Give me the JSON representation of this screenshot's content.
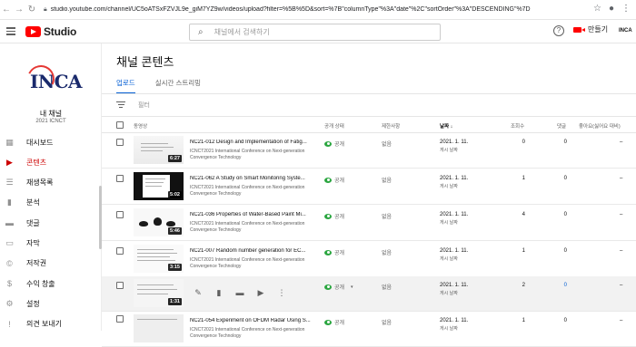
{
  "browser": {
    "url": "studio.youtube.com/channel/UC5oATSxFZVJL9e_giM7YZ9w/videos/upload?filter=%5B%5D&sort=%7B\"columnType\"%3A\"date\"%2C\"sortOrder\"%3A\"DESCENDING\"%7D"
  },
  "header": {
    "logo_text": "Studio",
    "search_placeholder": "채널에서 검색하기",
    "help_glyph": "?",
    "create_label": "만들기",
    "account_label": "INCA"
  },
  "sidebar": {
    "channel_logo": "INCA",
    "channel_label": "내 채널",
    "channel_name": "2021 ICNCT",
    "items": [
      {
        "label": "대시보드",
        "icon": "dashboard-icon",
        "glyph": "▦"
      },
      {
        "label": "콘텐츠",
        "icon": "content-icon",
        "glyph": "▶",
        "active": true
      },
      {
        "label": "재생목록",
        "icon": "playlist-icon",
        "glyph": "☰"
      },
      {
        "label": "분석",
        "icon": "analytics-icon",
        "glyph": "▮"
      },
      {
        "label": "댓글",
        "icon": "comments-icon",
        "glyph": "▬"
      },
      {
        "label": "자막",
        "icon": "subtitles-icon",
        "glyph": "▭"
      },
      {
        "label": "저작권",
        "icon": "copyright-icon",
        "glyph": "©"
      },
      {
        "label": "수익 창출",
        "icon": "monetization-icon",
        "glyph": "$"
      },
      {
        "label": "설정",
        "icon": "settings-icon",
        "glyph": "⚙"
      },
      {
        "label": "의견 보내기",
        "icon": "feedback-icon",
        "glyph": "!"
      }
    ]
  },
  "main": {
    "title": "채널 콘텐츠",
    "tabs": [
      {
        "label": "업로드",
        "active": true
      },
      {
        "label": "실시간 스트리밍",
        "active": false
      }
    ],
    "filter_label": "필터",
    "columns": {
      "video": "동영상",
      "visibility": "공개 상태",
      "restrictions": "제한사항",
      "date": "날짜 ↓",
      "views": "조회수",
      "comments": "댓글",
      "likes": "좋아요(싫어요 대비)"
    },
    "rows": [
      {
        "title": "NC21-012 Design and Implementation of Fatig...",
        "desc": "ICNCT2021 International Conference on Next-generation Convergence Technology",
        "duration": "6:27",
        "visibility": "공개",
        "restrictions": "없음",
        "date": "2021. 1. 11.",
        "date_sub": "게시 날짜",
        "views": "0",
        "comments": "0",
        "likes": "–"
      },
      {
        "title": "NC21-062 A Study on Smart Monitoring Syste...",
        "desc": "ICNCT2021 International Conference on Next-generation Convergence Technology",
        "duration": "5:02",
        "visibility": "공개",
        "restrictions": "없음",
        "date": "2021. 1. 11.",
        "date_sub": "게시 날짜",
        "views": "1",
        "comments": "0",
        "likes": "–"
      },
      {
        "title": "NC21-036 Properties of Water-Based Paint Mi...",
        "desc": "ICNCT2021 International Conference on Next-generation Convergence Technology",
        "duration": "5:46",
        "visibility": "공개",
        "restrictions": "없음",
        "date": "2021. 1. 11.",
        "date_sub": "게시 날짜",
        "views": "4",
        "comments": "0",
        "likes": "–"
      },
      {
        "title": "NC21-007 Random number generation for EC...",
        "desc": "ICNCT2021 International Conference on Next-generation Convergence Technology",
        "duration": "3:15",
        "visibility": "공개",
        "restrictions": "없음",
        "date": "2021. 1. 11.",
        "date_sub": "게시 날짜",
        "views": "1",
        "comments": "0",
        "likes": "–"
      },
      {
        "title": "",
        "desc": "",
        "duration": "1:31",
        "visibility": "공개",
        "restrictions": "없음",
        "date": "2021. 1. 11.",
        "date_sub": "게시 날짜",
        "views": "2",
        "comments": "0",
        "likes": "–"
      },
      {
        "title": "NC21-054 Experiment on OFDM Radar Using S...",
        "desc": "ICNCT2021 International Conference on Next-generation Convergence Technology",
        "duration": "",
        "visibility": "공개",
        "restrictions": "없음",
        "date": "2021. 1. 11.",
        "date_sub": "게시 날짜",
        "views": "1",
        "comments": "0",
        "likes": "–"
      }
    ]
  },
  "colors": {
    "accent_blue": "#065fd4",
    "active_red": "#cc0000",
    "public_green": "#2ba640",
    "youtube_red": "#ff0000"
  }
}
